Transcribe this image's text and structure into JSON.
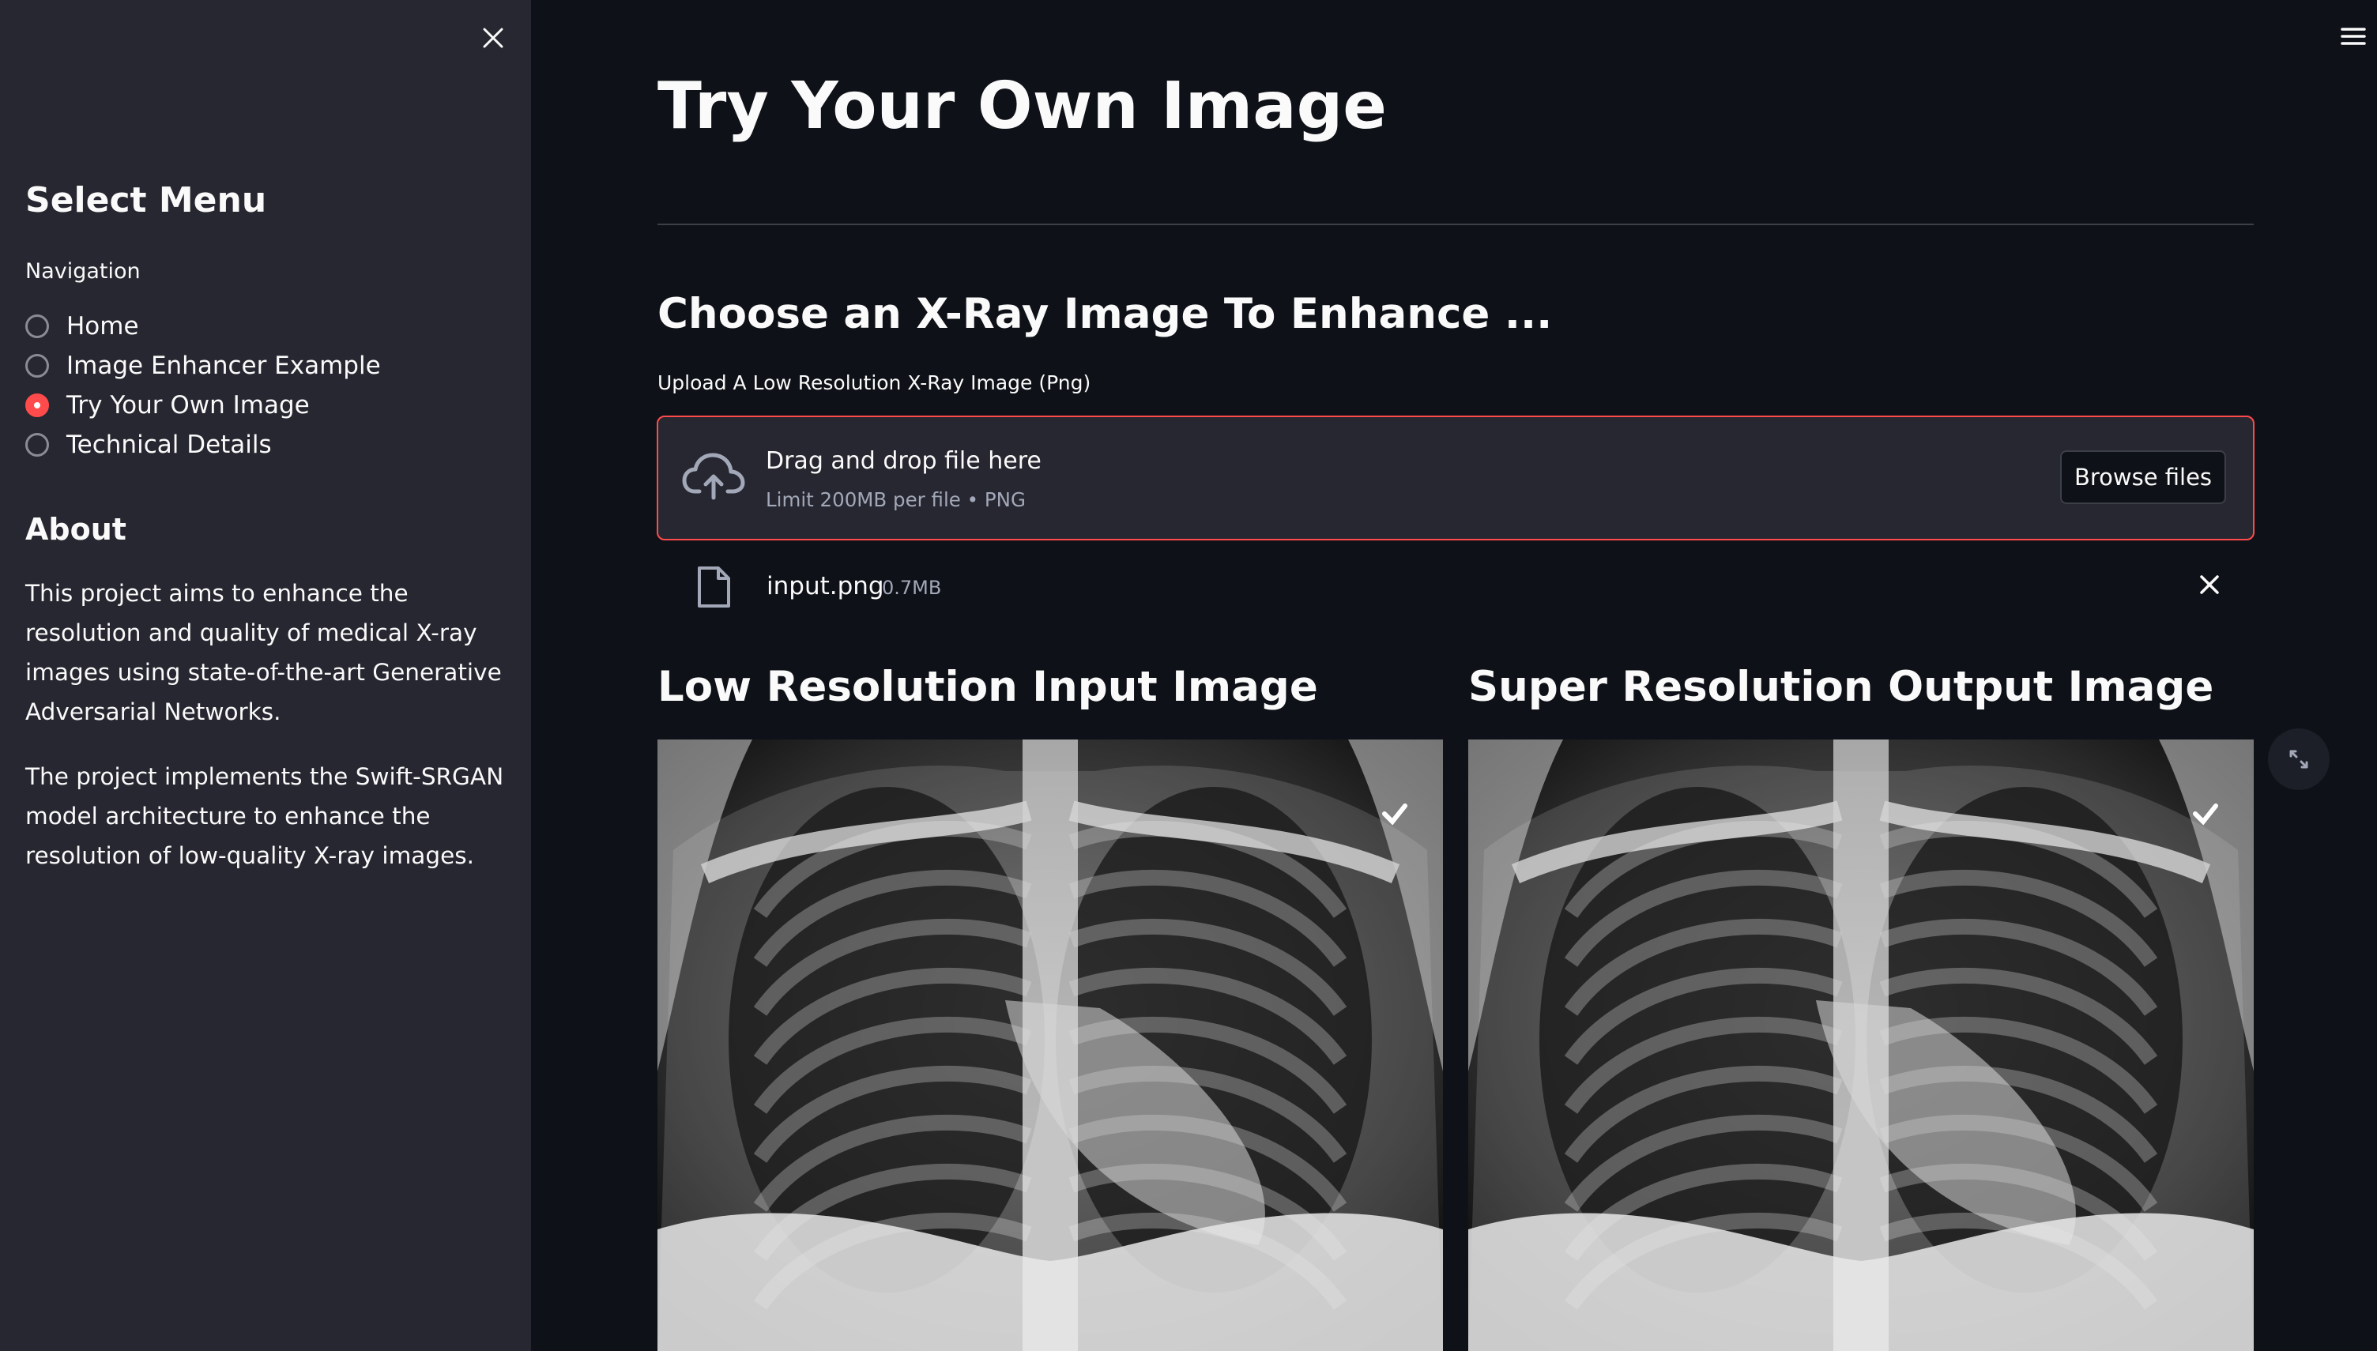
{
  "sidebar": {
    "title": "Select Menu",
    "nav_label": "Navigation",
    "nav_items": [
      {
        "label": "Home",
        "selected": false
      },
      {
        "label": "Image Enhancer Example",
        "selected": false
      },
      {
        "label": "Try Your Own Image",
        "selected": true
      },
      {
        "label": "Technical Details",
        "selected": false
      }
    ],
    "about_title": "About",
    "about_paragraphs": [
      "This project aims to enhance the resolution and quality of medical X-ray images using state-of-the-art Generative Adversarial Networks.",
      "The project implements the Swift-SRGAN model architecture to enhance the resolution of low-quality X-ray images."
    ]
  },
  "main": {
    "title": "Try Your Own Image",
    "section_heading": "Choose an X-Ray Image To Enhance ...",
    "upload_label": "Upload A Low Resolution X-Ray Image (Png)",
    "dropzone": {
      "main_text": "Drag and drop file here",
      "limit_text": "Limit 200MB per file • PNG",
      "browse_label": "Browse files"
    },
    "uploaded_file": {
      "name": "input.png",
      "size": "0.7MB"
    },
    "input_image_title": "Low Resolution Input Image",
    "output_image_title": "Super Resolution Output Image"
  },
  "colors": {
    "accent": "#ff4b4b",
    "background": "#0e1117",
    "sidebar_background": "#262730"
  },
  "icons": [
    "close-icon",
    "hamburger-menu-icon",
    "cloud-upload-icon",
    "file-icon",
    "remove-file-icon",
    "expand-icon"
  ]
}
